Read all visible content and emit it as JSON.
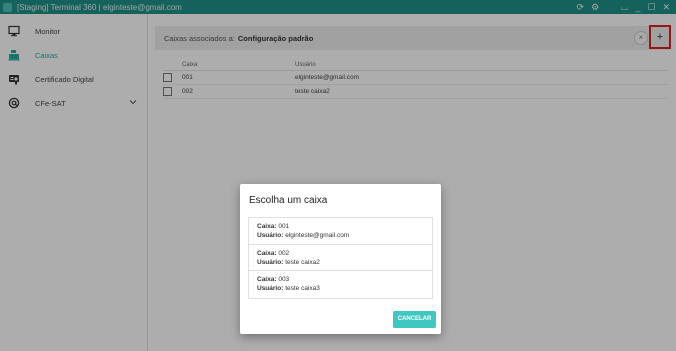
{
  "window": {
    "title": "[Staging] Terminal 360 | elginteste@gmail.com",
    "controls": [
      "sync-icon",
      "settings-icon",
      "tray-icon",
      "minimize-icon",
      "maximize-icon",
      "close-icon"
    ]
  },
  "sidebar": {
    "items": [
      {
        "label": "Monitor",
        "icon": "monitor-icon",
        "active": false
      },
      {
        "label": "Caixas",
        "icon": "cash-register-icon",
        "active": true
      },
      {
        "label": "Certificado Digital",
        "icon": "certificate-icon",
        "active": false
      },
      {
        "label": "CFe-SAT",
        "icon": "at-icon",
        "active": false,
        "expandable": true
      }
    ]
  },
  "panel": {
    "header_prefix": "Caixas associados a:",
    "header_bold": "Configuração padrão",
    "clear_symbol": "×",
    "add_symbol": "+"
  },
  "table": {
    "headers": {
      "caixa": "Caixa",
      "usuario": "Usuário"
    },
    "rows": [
      {
        "caixa": "001",
        "usuario": "elginteste@gmail.com"
      },
      {
        "caixa": "002",
        "usuario": "teste caixa2"
      }
    ]
  },
  "dialog": {
    "title": "Escolha um caixa",
    "caixa_label": "Caixa:",
    "usuario_label": "Usuário:",
    "items": [
      {
        "caixa": "001",
        "usuario": "elginteste@gmail.com"
      },
      {
        "caixa": "002",
        "usuario": "teste caixa2"
      },
      {
        "caixa": "003",
        "usuario": "teste caixa3"
      }
    ],
    "cancel_label": "CANCELAR"
  },
  "colors": {
    "titlebar": "#1f8f86",
    "accent": "#29a99e",
    "cancel_button": "#3fc7c2",
    "highlight_border": "#e02020"
  }
}
